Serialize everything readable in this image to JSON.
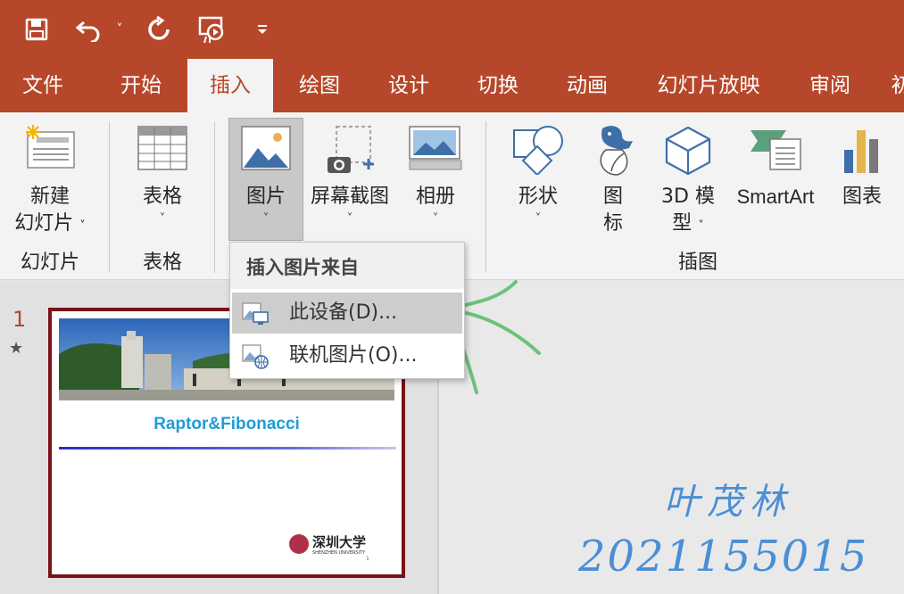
{
  "colors": {
    "accent": "#b7472a",
    "ribbon_bg": "#f3f3f3",
    "thumb_border": "#7a1218",
    "title_blue": "#1f9bd8",
    "handwriting": "#4a8fd6"
  },
  "quick_access": {
    "icons": [
      "save-icon",
      "undo-icon",
      "redo-icon",
      "present-icon",
      "customize-icon"
    ]
  },
  "tabs": [
    {
      "label": "文件"
    },
    {
      "label": "开始"
    },
    {
      "label": "插入",
      "active": true
    },
    {
      "label": "绘图"
    },
    {
      "label": "设计"
    },
    {
      "label": "切换"
    },
    {
      "label": "动画"
    },
    {
      "label": "幻灯片放映"
    },
    {
      "label": "审阅"
    },
    {
      "label": "初"
    }
  ],
  "ribbon": {
    "new_slide": {
      "line1": "新建",
      "line2": "幻灯片",
      "chev": "˅"
    },
    "table": {
      "line1": "表格",
      "chev": "˅"
    },
    "picture": {
      "line1": "图片",
      "chev": "˅"
    },
    "screenshot": {
      "line1": "屏幕截图",
      "chev": "˅"
    },
    "album": {
      "line1": "相册",
      "chev": "˅"
    },
    "shapes": {
      "line1": "形状",
      "chev": "˅"
    },
    "icons": {
      "line1": "图",
      "line2": "标"
    },
    "model3d": {
      "line1": "3D 模",
      "line2": "型",
      "chev": "˅"
    },
    "smartart": {
      "line1": "SmartArt"
    },
    "chart": {
      "line1": "图表"
    },
    "groups": {
      "slides": "幻灯片",
      "tables": "表格",
      "illustrations": "插图"
    }
  },
  "dropdown": {
    "header": "插入图片来自",
    "items": [
      {
        "label": "此设备(D)..."
      },
      {
        "label": "联机图片(O)..."
      }
    ]
  },
  "slides_pane": {
    "number": "1",
    "star": "★"
  },
  "slide": {
    "title": "Raptor&Fibonacci",
    "logo_text": "深圳大学",
    "logo_sub": "SHENZHEN UNIVERSITY",
    "page_no": "1"
  },
  "notes": {
    "name": "叶茂林",
    "id": "2021155015"
  }
}
